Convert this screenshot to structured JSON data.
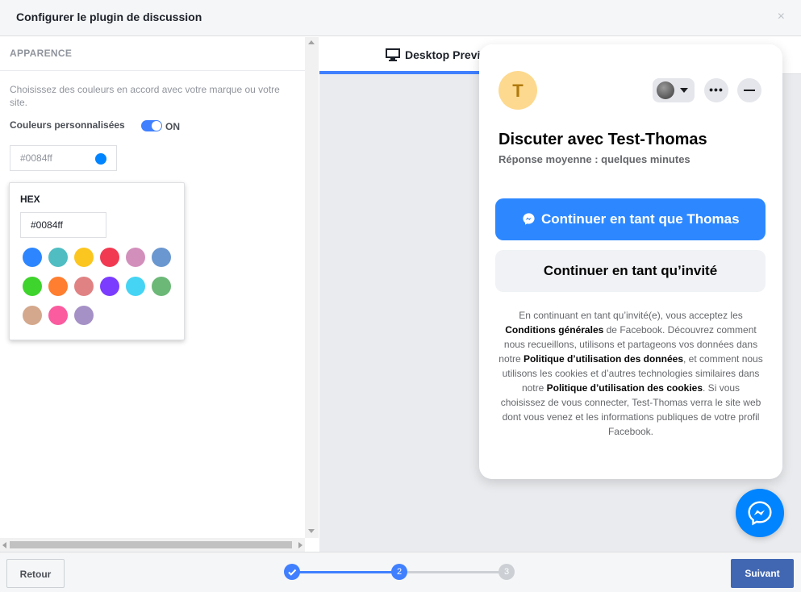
{
  "header": {
    "title": "Configurer le plugin de discussion",
    "close_label": "×"
  },
  "left_panel": {
    "section_title": "APPARENCE",
    "description": "Choisissez des couleurs en accord avec votre marque ou votre site.",
    "custom_colors_label": "Couleurs personnalisées",
    "toggle_state": "ON",
    "color_value": "#0084ff",
    "color_picker": {
      "hex_label": "HEX",
      "hex_value": "#0084ff",
      "swatches": [
        "#2d86ff",
        "#4fbdc2",
        "#fcc620",
        "#f13a52",
        "#d38fbc",
        "#6a97cf",
        "#3fd32d",
        "#ff7e2f",
        "#e08284",
        "#7b3cff",
        "#45d4f4",
        "#6cb877",
        "#d4a88c",
        "#fa5c9f",
        "#a591c6"
      ]
    }
  },
  "preview": {
    "tab_label": "Desktop Previ",
    "chat": {
      "avatar_letter": "T",
      "more_label": "•••",
      "title": "Discuter avec Test-Thomas",
      "subtitle": "Réponse moyenne : quelques minutes",
      "primary_button": "Continuer en tant que Thomas",
      "guest_button": "Continuer en tant qu’invité",
      "legal": {
        "p1": "En continuant en tant qu’invité(e), vous acceptez les ",
        "b1": "Conditions générales",
        "p2": " de Facebook. Découvrez comment nous recueillons, utilisons et partageons vos données dans notre ",
        "b2": "Politique d’utilisation des données",
        "p3": ", et comment nous utilisons les cookies et d’autres technologies similaires dans notre ",
        "b3": "Politique d’utilisation des cookies",
        "p4": ". Si vous choisissez de vous connecter, Test-Thomas verra le site web dont vous venez et les informations publiques de votre profil Facebook."
      }
    }
  },
  "footer": {
    "back_label": "Retour",
    "next_label": "Suivant",
    "steps": [
      {
        "label": "",
        "state": "done"
      },
      {
        "label": "2",
        "state": "current"
      },
      {
        "label": "3",
        "state": "upcoming"
      }
    ]
  },
  "colors": {
    "accent": "#4080ff",
    "messenger": "#0084ff",
    "next_button": "#4267b2"
  }
}
